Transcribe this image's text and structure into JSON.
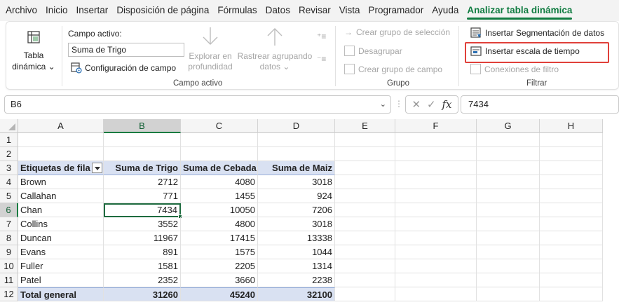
{
  "menu": {
    "tabs": [
      "Archivo",
      "Inicio",
      "Insertar",
      "Disposición de página",
      "Fórmulas",
      "Datos",
      "Revisar",
      "Vista",
      "Programador",
      "Ayuda",
      "Analizar tabla dinámica"
    ],
    "active_tab": "Analizar tabla dinámica"
  },
  "ribbon": {
    "tabla_dinamica": {
      "line1": "Tabla",
      "line2": "dinámica",
      "chevron": "⌄"
    },
    "campo_activo": {
      "label": "Campo activo:",
      "value": "Suma de Trigo",
      "config_label": "Configuración de campo",
      "explore_line1": "Explorar en",
      "explore_line2": "profundidad",
      "drill_line1": "Rastrear agrupando",
      "drill_line2": "datos",
      "group_label": "Campo activo"
    },
    "grupo": {
      "crear_seleccion": "Crear grupo de selección",
      "desagrupar": "Desagrupar",
      "crear_campo": "Crear grupo de campo",
      "group_label": "Grupo"
    },
    "filtrar": {
      "segmentacion": "Insertar Segmentación de datos",
      "escala": "Insertar escala de tiempo",
      "conexiones": "Conexiones de filtro",
      "group_label": "Filtrar"
    }
  },
  "formula_bar": {
    "name_box": "B6",
    "fx_symbol": "fx",
    "value": "7434"
  },
  "sheet": {
    "columns": [
      "A",
      "B",
      "C",
      "D",
      "E",
      "F",
      "G",
      "H"
    ],
    "rows": [
      "1",
      "2",
      "3",
      "4",
      "5",
      "6",
      "7",
      "8",
      "9",
      "10",
      "11",
      "12"
    ],
    "selected_cell": "B6",
    "pivot": {
      "headers": [
        "Etiquetas de fila",
        "Suma de Trigo",
        "Suma de Cebada",
        "Suma de Maiz"
      ],
      "rows": [
        [
          "Brown",
          "2712",
          "4080",
          "3018"
        ],
        [
          "Callahan",
          "771",
          "1455",
          "924"
        ],
        [
          "Chan",
          "7434",
          "10050",
          "7206"
        ],
        [
          "Collins",
          "3552",
          "4800",
          "3018"
        ],
        [
          "Duncan",
          "11967",
          "17415",
          "13338"
        ],
        [
          "Evans",
          "891",
          "1575",
          "1044"
        ],
        [
          "Fuller",
          "1581",
          "2205",
          "1314"
        ],
        [
          "Patel",
          "2352",
          "3660",
          "2238"
        ]
      ],
      "total": [
        "Total general",
        "31260",
        "45240",
        "32100"
      ]
    }
  },
  "colors": {
    "accent": "#107c41",
    "pivot_header_bg": "#d9e1f2",
    "highlight_border": "#e0403a"
  }
}
